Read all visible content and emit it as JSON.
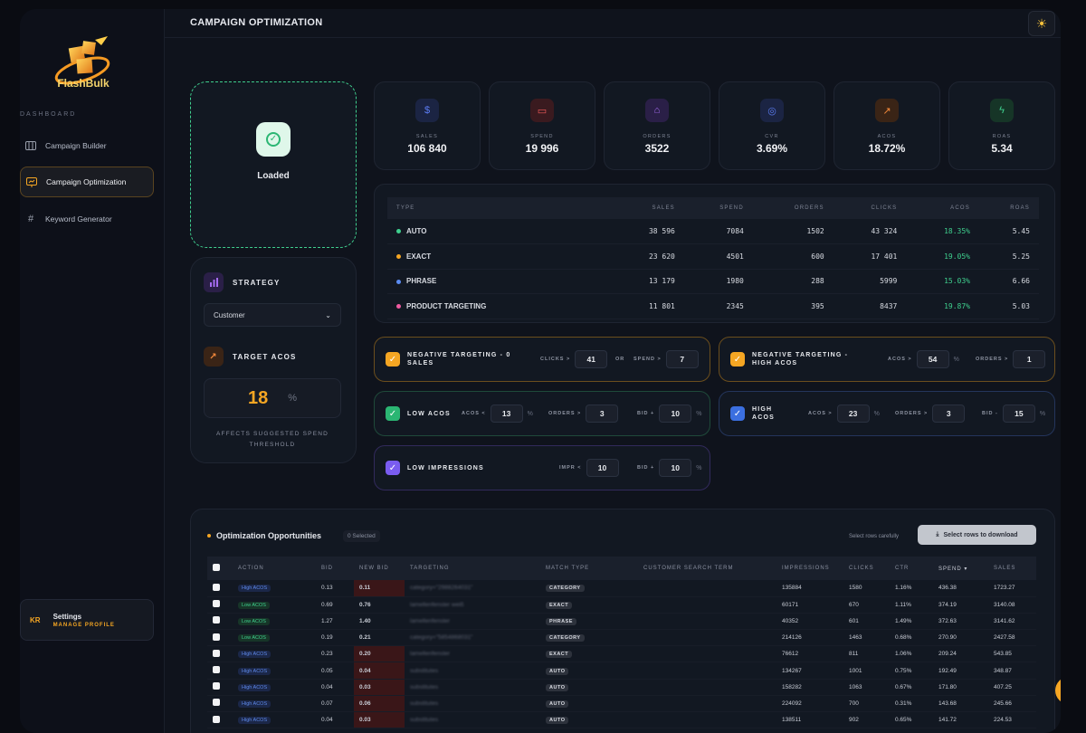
{
  "app": {
    "name": "FlashBulk",
    "page_title": "CAMPAIGN OPTIMIZATION"
  },
  "sidebar": {
    "section": "DASHBOARD",
    "items": [
      {
        "label": "Campaign Builder",
        "icon": "columns-icon"
      },
      {
        "label": "Campaign Optimization",
        "icon": "chart-screen-icon",
        "active": true
      },
      {
        "label": "Keyword Generator",
        "icon": "hash-icon"
      }
    ],
    "profile": {
      "initials": "KR",
      "title": "Settings",
      "subtitle": "MANAGE PROFILE"
    }
  },
  "status": {
    "label": "Loaded"
  },
  "strategy": {
    "title": "STRATEGY",
    "selected": "Customer",
    "target_title": "TARGET ACOS",
    "target_value": "18",
    "target_unit": "%",
    "note": "AFFECTS SUGGESTED SPEND THRESHOLD"
  },
  "metrics": [
    {
      "label": "SALES",
      "value": "106 840",
      "icon": "dollar-icon",
      "color": "#5b7cf2"
    },
    {
      "label": "SPEND",
      "value": "19 996",
      "icon": "card-icon",
      "color": "#f05a5a"
    },
    {
      "label": "ORDERS",
      "value": "3522",
      "icon": "bag-icon",
      "color": "#a66cf2"
    },
    {
      "label": "CVR",
      "value": "3.69%",
      "icon": "target-icon",
      "color": "#5b7cf2"
    },
    {
      "label": "ACOS",
      "value": "18.72%",
      "icon": "trend-icon",
      "color": "#f58a3b"
    },
    {
      "label": "ROAS",
      "value": "5.34",
      "icon": "bolt-icon",
      "color": "#3fcf8e"
    }
  ],
  "type_table": {
    "headers": [
      "TYPE",
      "SALES",
      "SPEND",
      "ORDERS",
      "CLICKS",
      "ACOS",
      "ROAS"
    ],
    "rows": [
      {
        "type": "AUTO",
        "dot": "#3fcf8e",
        "sales": "38 596",
        "spend": "7084",
        "orders": "1502",
        "clicks": "43 324",
        "acos": "18.35%",
        "roas": "5.45"
      },
      {
        "type": "EXACT",
        "dot": "#f5a623",
        "sales": "23 620",
        "spend": "4501",
        "orders": "600",
        "clicks": "17 401",
        "acos": "19.05%",
        "roas": "5.25"
      },
      {
        "type": "PHRASE",
        "dot": "#5b8cf2",
        "sales": "13 179",
        "spend": "1980",
        "orders": "288",
        "clicks": "5999",
        "acos": "15.03%",
        "roas": "6.66"
      },
      {
        "type": "PRODUCT TARGETING",
        "dot": "#f05aa0",
        "sales": "11 801",
        "spend": "2345",
        "orders": "395",
        "clicks": "8437",
        "acos": "19.87%",
        "roas": "5.03"
      }
    ]
  },
  "rules": {
    "neg_zero": {
      "title": "NEGATIVE TARGETING - 0 SALES",
      "f1": "CLICKS >",
      "v1": "41",
      "or": "OR",
      "f2": "SPEND >",
      "v2": "7"
    },
    "neg_high": {
      "title": "NEGATIVE TARGETING - HIGH ACOS",
      "f1": "ACOS >",
      "v1": "54",
      "u1": "%",
      "f2": "ORDERS >",
      "v2": "1"
    },
    "low_acos": {
      "title": "LOW ACOS",
      "f1": "ACOS <",
      "v1": "13",
      "u1": "%",
      "f2": "ORDERS >",
      "v2": "3",
      "f3": "BID +",
      "v3": "10",
      "u3": "%"
    },
    "high_acos": {
      "title": "HIGH ACOS",
      "f1": "ACOS >",
      "v1": "23",
      "u1": "%",
      "f2": "ORDERS >",
      "v2": "3",
      "f3": "BID -",
      "v3": "15",
      "u3": "%"
    },
    "low_impr": {
      "title": "LOW IMPRESSIONS",
      "f1": "IMPR <",
      "v1": "10",
      "f2": "BID +",
      "v2": "10",
      "u2": "%"
    }
  },
  "opportunities": {
    "title": "Optimization Opportunities",
    "selected": "0 Selected",
    "hint": "Select rows carefully",
    "download": "Select rows to download",
    "headers": [
      "ACTION",
      "BID",
      "NEW BID",
      "TARGETING",
      "MATCH TYPE",
      "CUSTOMER SEARCH TERM",
      "IMPRESSIONS",
      "CLICKS",
      "CTR",
      "SPEND ▾",
      "SALES"
    ],
    "rows": [
      {
        "action": "High ACOS",
        "kind": "hi",
        "bid": "0.13",
        "new_bid": "0.11",
        "targeting": "category=\"2988264031\"",
        "match": "CATEGORY",
        "impr": "135884",
        "clicks": "1580",
        "ctr": "1.16%",
        "spend": "436.38",
        "sales": "1723.27"
      },
      {
        "action": "Low ACOS",
        "kind": "lo",
        "bid": "0.69",
        "new_bid": "0.76",
        "targeting": "lamellenfenster weiß",
        "match": "EXACT",
        "impr": "60171",
        "clicks": "670",
        "ctr": "1.11%",
        "spend": "374.19",
        "sales": "3140.08"
      },
      {
        "action": "Low ACOS",
        "kind": "lo",
        "bid": "1.27",
        "new_bid": "1.40",
        "targeting": "lamellenfenster",
        "match": "PHRASE",
        "impr": "40352",
        "clicks": "601",
        "ctr": "1.49%",
        "spend": "372.63",
        "sales": "3141.62"
      },
      {
        "action": "Low ACOS",
        "kind": "lo",
        "bid": "0.19",
        "new_bid": "0.21",
        "targeting": "category=\"5854868031\"",
        "match": "CATEGORY",
        "impr": "214126",
        "clicks": "1463",
        "ctr": "0.68%",
        "spend": "270.90",
        "sales": "2427.58"
      },
      {
        "action": "High ACOS",
        "kind": "hi",
        "bid": "0.23",
        "new_bid": "0.20",
        "targeting": "lamellenfenster",
        "match": "EXACT",
        "impr": "76612",
        "clicks": "811",
        "ctr": "1.06%",
        "spend": "209.24",
        "sales": "543.85"
      },
      {
        "action": "High ACOS",
        "kind": "hi",
        "bid": "0.05",
        "new_bid": "0.04",
        "targeting": "substitutes",
        "match": "AUTO",
        "impr": "134267",
        "clicks": "1001",
        "ctr": "0.75%",
        "spend": "192.49",
        "sales": "348.87"
      },
      {
        "action": "High ACOS",
        "kind": "hi",
        "bid": "0.04",
        "new_bid": "0.03",
        "targeting": "substitutes",
        "match": "AUTO",
        "impr": "158282",
        "clicks": "1063",
        "ctr": "0.67%",
        "spend": "171.80",
        "sales": "407.25"
      },
      {
        "action": "High ACOS",
        "kind": "hi",
        "bid": "0.07",
        "new_bid": "0.06",
        "targeting": "substitutes",
        "match": "AUTO",
        "impr": "224092",
        "clicks": "700",
        "ctr": "0.31%",
        "spend": "143.68",
        "sales": "245.66"
      },
      {
        "action": "High ACOS",
        "kind": "hi",
        "bid": "0.04",
        "new_bid": "0.03",
        "targeting": "substitutes",
        "match": "AUTO",
        "impr": "138511",
        "clicks": "902",
        "ctr": "0.65%",
        "spend": "141.72",
        "sales": "224.53"
      }
    ]
  }
}
